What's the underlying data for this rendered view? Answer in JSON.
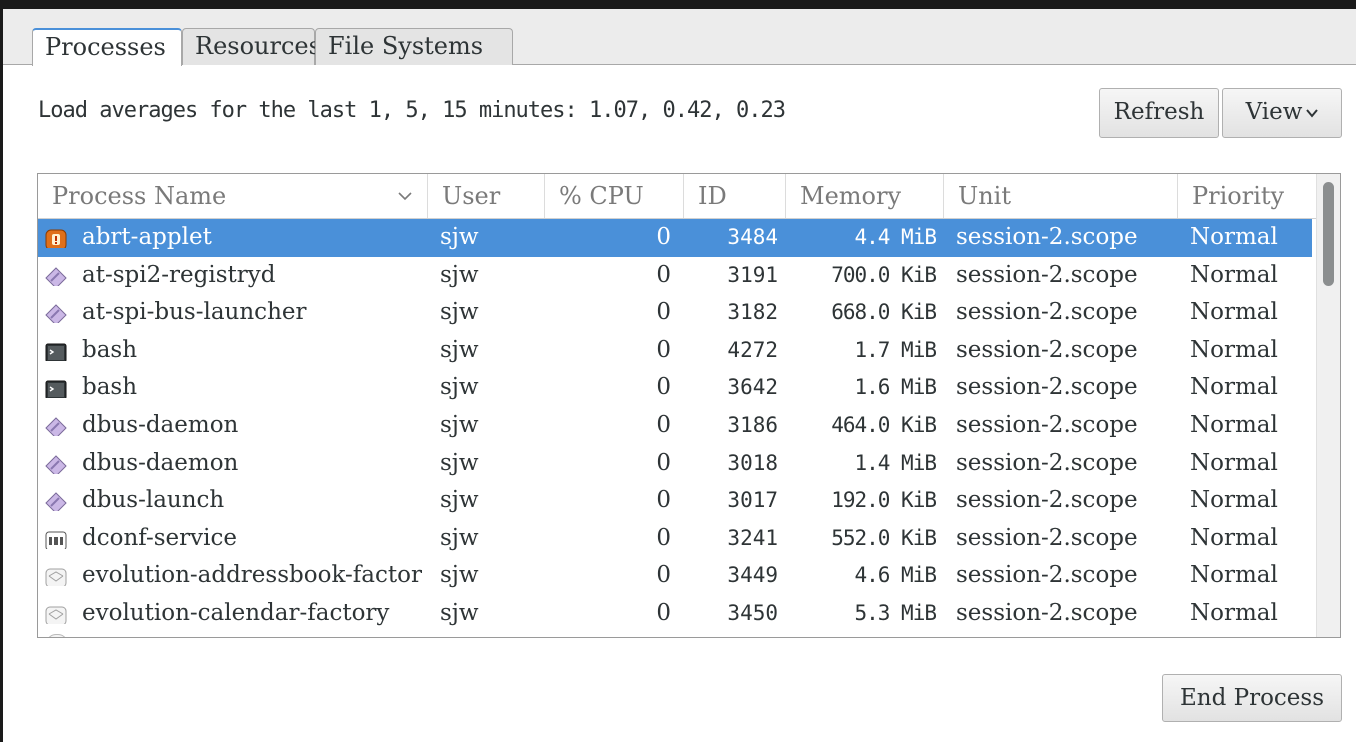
{
  "tabs": [
    {
      "label": "Processes",
      "active": true
    },
    {
      "label": "Resources",
      "active": false
    },
    {
      "label": "File Systems",
      "active": false
    }
  ],
  "load_averages": "Load averages for the last 1, 5, 15 minutes: 1.07, 0.42, 0.23",
  "buttons": {
    "refresh": "Refresh",
    "view": "View",
    "end_process": "End Process"
  },
  "columns": {
    "name": "Process Name",
    "user": "User",
    "cpu": "% CPU",
    "id": "ID",
    "memory": "Memory",
    "unit": "Unit",
    "priority": "Priority"
  },
  "selection_color": "#4a90d9",
  "rows": [
    {
      "icon": "abrt-icon",
      "name": "abrt-applet",
      "user": "sjw",
      "cpu": "0",
      "id": "3484",
      "memory": "4.4 MiB",
      "unit": "session-2.scope",
      "priority": "Normal",
      "selected": true
    },
    {
      "icon": "generic-diamond-icon",
      "name": "at-spi2-registryd",
      "user": "sjw",
      "cpu": "0",
      "id": "3191",
      "memory": "700.0 KiB",
      "unit": "session-2.scope",
      "priority": "Normal"
    },
    {
      "icon": "generic-diamond-icon",
      "name": "at-spi-bus-launcher",
      "user": "sjw",
      "cpu": "0",
      "id": "3182",
      "memory": "668.0 KiB",
      "unit": "session-2.scope",
      "priority": "Normal"
    },
    {
      "icon": "terminal-icon",
      "name": "bash",
      "user": "sjw",
      "cpu": "0",
      "id": "4272",
      "memory": "1.7 MiB",
      "unit": "session-2.scope",
      "priority": "Normal"
    },
    {
      "icon": "terminal-icon",
      "name": "bash",
      "user": "sjw",
      "cpu": "0",
      "id": "3642",
      "memory": "1.6 MiB",
      "unit": "session-2.scope",
      "priority": "Normal"
    },
    {
      "icon": "generic-diamond-icon",
      "name": "dbus-daemon",
      "user": "sjw",
      "cpu": "0",
      "id": "3186",
      "memory": "464.0 KiB",
      "unit": "session-2.scope",
      "priority": "Normal"
    },
    {
      "icon": "generic-diamond-icon",
      "name": "dbus-daemon",
      "user": "sjw",
      "cpu": "0",
      "id": "3018",
      "memory": "1.4 MiB",
      "unit": "session-2.scope",
      "priority": "Normal"
    },
    {
      "icon": "generic-diamond-icon",
      "name": "dbus-launch",
      "user": "sjw",
      "cpu": "0",
      "id": "3017",
      "memory": "192.0 KiB",
      "unit": "session-2.scope",
      "priority": "Normal"
    },
    {
      "icon": "dconf-icon",
      "name": "dconf-service",
      "user": "sjw",
      "cpu": "0",
      "id": "3241",
      "memory": "552.0 KiB",
      "unit": "session-2.scope",
      "priority": "Normal"
    },
    {
      "icon": "envelope-icon",
      "name": "evolution-addressbook-factor",
      "user": "sjw",
      "cpu": "0",
      "id": "3449",
      "memory": "4.6 MiB",
      "unit": "session-2.scope",
      "priority": "Normal"
    },
    {
      "icon": "envelope-icon",
      "name": "evolution-calendar-factory",
      "user": "sjw",
      "cpu": "0",
      "id": "3450",
      "memory": "5.3 MiB",
      "unit": "session-2.scope",
      "priority": "Normal"
    }
  ]
}
